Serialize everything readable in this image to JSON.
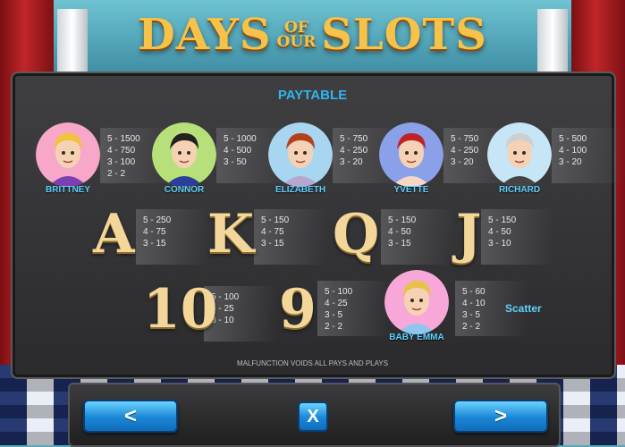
{
  "logo": {
    "word1": "DAYS",
    "of": "OF",
    "our": "OUR",
    "word2": "SLOTS"
  },
  "title": "PAYTABLE",
  "characters": [
    {
      "name": "BRITTNEY",
      "pays": [
        "5 - 1500",
        "4 - 750",
        "3 - 100",
        "2 - 2"
      ],
      "hair": "#f2c23a",
      "bg": "#f7a8c8",
      "shirt": "#7b3fb2"
    },
    {
      "name": "CONNOR",
      "pays": [
        "5 - 1000",
        "4 - 500",
        "3 - 50"
      ],
      "hair": "#222222",
      "bg": "#b8e07a",
      "shirt": "#2c3e9a"
    },
    {
      "name": "ELIZABETH",
      "pays": [
        "5 - 750",
        "4 - 250",
        "3 - 20"
      ],
      "hair": "#b5401e",
      "bg": "#a8d6f0",
      "shirt": "#b5a8d0"
    },
    {
      "name": "YVETTE",
      "pays": [
        "5 - 750",
        "4 - 250",
        "3 - 20"
      ],
      "hair": "#c0202a",
      "bg": "#8aa0e8",
      "shirt": "#f5d7c8"
    },
    {
      "name": "RICHARD",
      "pays": [
        "5 - 500",
        "4 - 100",
        "3 - 20"
      ],
      "hair": "#cfcfcf",
      "bg": "#c6e6f6",
      "shirt": "#444444"
    }
  ],
  "cards": [
    {
      "symbol": "A",
      "pays": [
        "5 - 250",
        "4 - 75",
        "3 - 15"
      ]
    },
    {
      "symbol": "K",
      "pays": [
        "5 - 150",
        "4 - 75",
        "3 - 15"
      ]
    },
    {
      "symbol": "Q",
      "pays": [
        "5 - 150",
        "4 - 50",
        "3 - 15"
      ]
    },
    {
      "symbol": "J",
      "pays": [
        "5 - 150",
        "4 - 50",
        "3 - 10"
      ]
    },
    {
      "symbol": "10",
      "pays": [
        "5 - 100",
        "4 - 25",
        "3 - 10"
      ]
    },
    {
      "symbol": "9",
      "pays": [
        "5 - 100",
        "4 - 25",
        "3 - 5",
        "2 - 2"
      ]
    }
  ],
  "scatter": {
    "name": "BABY EMMA",
    "pays": [
      "5 - 60",
      "4 - 10",
      "3 - 5",
      "2 - 2"
    ],
    "label": "Scatter"
  },
  "footer": "MALFUNCTION VOIDS ALL PAYS AND PLAYS",
  "controls": {
    "prev": "<",
    "close": "X",
    "next": ">"
  }
}
